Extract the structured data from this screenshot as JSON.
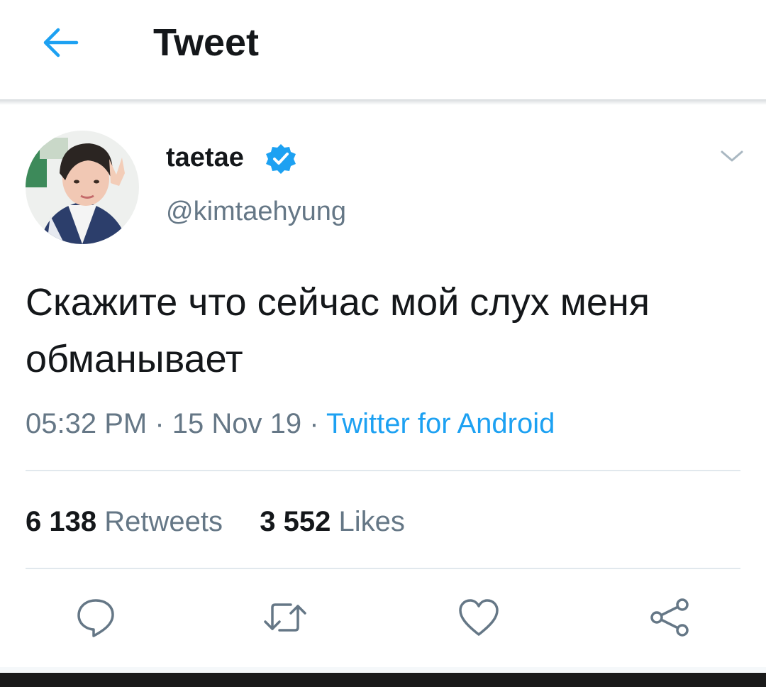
{
  "header": {
    "title": "Tweet",
    "back_icon": "arrow-left-icon",
    "accent_color": "#1da1f2"
  },
  "tweet": {
    "author": {
      "display_name": "taetae",
      "handle": "@kimtaehyung",
      "verified": true
    },
    "text": "Скажите что сейчас мой слух меня обманывает",
    "time": "05:32 PM",
    "date": "15 Nov 19",
    "separator": "·",
    "source": "Twitter for Android",
    "stats": {
      "retweets_count": "6 138",
      "retweets_label": "Retweets",
      "likes_count": "3 552",
      "likes_label": "Likes"
    }
  },
  "actions": [
    {
      "name": "reply",
      "icon": "speech-bubble-icon"
    },
    {
      "name": "retweet",
      "icon": "retweet-icon"
    },
    {
      "name": "like",
      "icon": "heart-icon"
    },
    {
      "name": "share",
      "icon": "share-icon"
    }
  ]
}
